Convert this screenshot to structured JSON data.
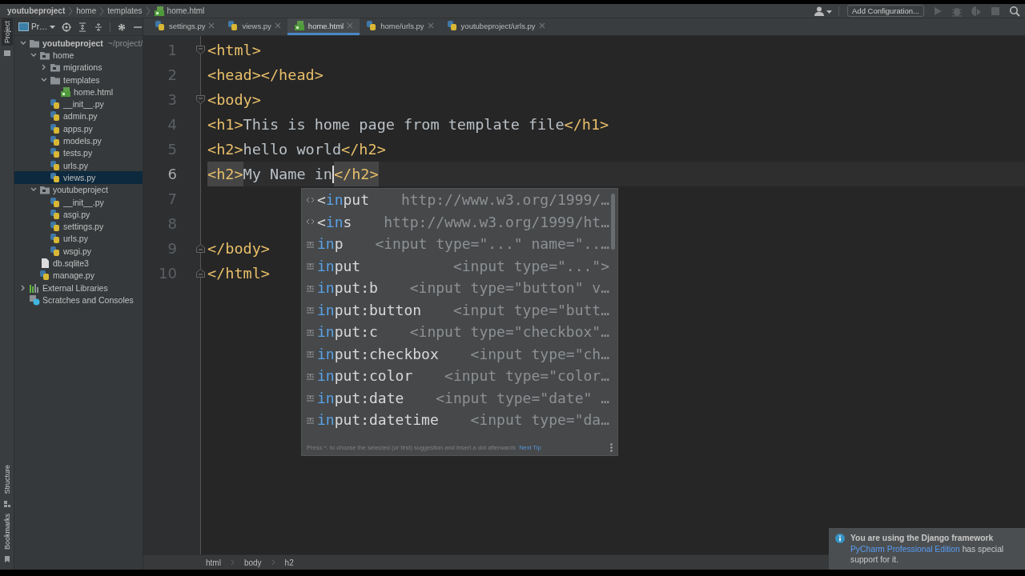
{
  "navbar": {
    "crumbs": [
      {
        "text": "youtubeproject",
        "kind": "project"
      },
      {
        "text": "home",
        "kind": "folder"
      },
      {
        "text": "templates",
        "kind": "folder"
      },
      {
        "text": "home.html",
        "kind": "html"
      }
    ],
    "config_button": "Add Configuration...",
    "actions": [
      {
        "kind": "run",
        "disabled": true
      },
      {
        "kind": "debug",
        "disabled": true
      },
      {
        "kind": "coverage",
        "disabled": true
      },
      {
        "kind": "stop",
        "disabled": true
      },
      {
        "kind": "search",
        "disabled": false
      }
    ]
  },
  "tool_strip": {
    "top": [
      "Project"
    ],
    "bottom": [
      "Structure",
      "Bookmarks"
    ]
  },
  "project_panel": {
    "title": "Pr…",
    "tree": [
      {
        "name": "youtubeproject",
        "note": "~/project/",
        "kind": "root",
        "expanded": true,
        "selected": false,
        "children": [
          {
            "name": "home",
            "kind": "module",
            "expanded": true,
            "selected": false,
            "children": [
              {
                "name": "migrations",
                "kind": "module",
                "expanded": false,
                "selected": false
              },
              {
                "name": "templates",
                "kind": "folder",
                "expanded": true,
                "selected": false,
                "children": [
                  {
                    "name": "home.html",
                    "kind": "html",
                    "selected": false
                  }
                ]
              },
              {
                "name": "__init__.py",
                "kind": "python",
                "selected": false
              },
              {
                "name": "admin.py",
                "kind": "python",
                "selected": false
              },
              {
                "name": "apps.py",
                "kind": "python",
                "selected": false
              },
              {
                "name": "models.py",
                "kind": "python",
                "selected": false
              },
              {
                "name": "tests.py",
                "kind": "python",
                "selected": false
              },
              {
                "name": "urls.py",
                "kind": "python",
                "selected": false
              },
              {
                "name": "views.py",
                "kind": "python",
                "selected": true
              }
            ]
          },
          {
            "name": "youtubeproject",
            "kind": "module",
            "expanded": true,
            "selected": false,
            "children": [
              {
                "name": "__init__.py",
                "kind": "python",
                "selected": false
              },
              {
                "name": "asgi.py",
                "kind": "python",
                "selected": false
              },
              {
                "name": "settings.py",
                "kind": "python",
                "selected": false
              },
              {
                "name": "urls.py",
                "kind": "python",
                "selected": false
              },
              {
                "name": "wsgi.py",
                "kind": "python",
                "selected": false
              }
            ]
          },
          {
            "name": "db.sqlite3",
            "kind": "file",
            "selected": false
          },
          {
            "name": "manage.py",
            "kind": "python",
            "selected": false
          }
        ]
      },
      {
        "name": "External Libraries",
        "kind": "libraries",
        "expanded": false,
        "selected": false
      },
      {
        "name": "Scratches and Consoles",
        "kind": "scratches",
        "selected": false
      }
    ]
  },
  "tabs": [
    {
      "label": "settings.py",
      "kind": "python",
      "selected": false
    },
    {
      "label": "views.py",
      "kind": "python",
      "selected": false
    },
    {
      "label": "home.html",
      "kind": "html",
      "selected": true
    },
    {
      "label": "home/urls.py",
      "kind": "python",
      "selected": false
    },
    {
      "label": "youtubeproject/urls.py",
      "kind": "python",
      "selected": false
    }
  ],
  "editor": {
    "lines": [
      {
        "number": "1",
        "current": false,
        "fold_start": true,
        "tokens": [
          {
            "kind": "tag",
            "text": "<html>"
          }
        ]
      },
      {
        "number": "2",
        "current": false,
        "tokens": [
          {
            "kind": "tag",
            "text": "<head></head>"
          }
        ]
      },
      {
        "number": "3",
        "current": false,
        "fold_start": true,
        "tokens": [
          {
            "kind": "tag",
            "text": "<body>"
          }
        ]
      },
      {
        "number": "4",
        "current": false,
        "tokens": [
          {
            "kind": "tag",
            "text": "<h1>"
          },
          {
            "kind": "text",
            "text": "This is home page from template file"
          },
          {
            "kind": "tag",
            "text": "</h1>"
          }
        ]
      },
      {
        "number": "5",
        "current": false,
        "tokens": [
          {
            "kind": "tag",
            "text": "<h2>"
          },
          {
            "kind": "text",
            "text": "hello world"
          },
          {
            "kind": "tag",
            "text": "</h2>"
          }
        ]
      },
      {
        "number": "6",
        "current": true,
        "tokens": [
          {
            "kind": "tag",
            "text": "<h2>",
            "matched": true
          },
          {
            "kind": "text",
            "text": "My Name in"
          },
          {
            "kind": "caret"
          },
          {
            "kind": "tag",
            "text": "</h2>",
            "matched": true
          }
        ]
      },
      {
        "number": "7",
        "current": false
      },
      {
        "number": "8",
        "current": false
      },
      {
        "number": "9",
        "current": false,
        "fold_end": true,
        "tokens": [
          {
            "kind": "tag",
            "text": "</body>"
          }
        ]
      },
      {
        "number": "10",
        "current": false,
        "fold_end": true,
        "tokens": [
          {
            "kind": "tag",
            "text": "</html>"
          }
        ]
      }
    ],
    "completion": {
      "items": [
        {
          "kind": "tag",
          "before": "<",
          "match": "in",
          "after": "put",
          "hint": "http://www.w3.org/1999/…"
        },
        {
          "kind": "tag",
          "before": "<",
          "match": "in",
          "after": "s",
          "hint": "http://www.w3.org/1999/ht…"
        },
        {
          "kind": "template",
          "match": "in",
          "after": "p",
          "hint": "<input type=\"...\" name=\"..…"
        },
        {
          "kind": "template",
          "match": "in",
          "after": "put",
          "hint": "<input type=\"...\">"
        },
        {
          "kind": "template",
          "match": "in",
          "after": "put:b",
          "hint": "<input type=\"button\" v…"
        },
        {
          "kind": "template",
          "match": "in",
          "after": "put:button",
          "hint": "<input type=\"butt…"
        },
        {
          "kind": "template",
          "match": "in",
          "after": "put:c",
          "hint": "<input type=\"checkbox\"…"
        },
        {
          "kind": "template",
          "match": "in",
          "after": "put:checkbox",
          "hint": "<input type=\"ch…"
        },
        {
          "kind": "template",
          "match": "in",
          "after": "put:color",
          "hint": "<input type=\"color…"
        },
        {
          "kind": "template",
          "match": "in",
          "after": "put:date",
          "hint": "<input type=\"date\" …"
        },
        {
          "kind": "template",
          "match": "in",
          "after": "put:datetime",
          "hint": "<input type=\"da…"
        }
      ],
      "tip": "Press ^. to choose the selected (or first) suggestion and insert a dot afterwards",
      "tip_link": "Next Tip"
    }
  },
  "breadcrumbs": [
    "html",
    "body",
    "h2"
  ],
  "notification": {
    "title": "You are using the Django framework",
    "link": "PyCharm Professional Edition",
    "text": " has special support for it."
  }
}
